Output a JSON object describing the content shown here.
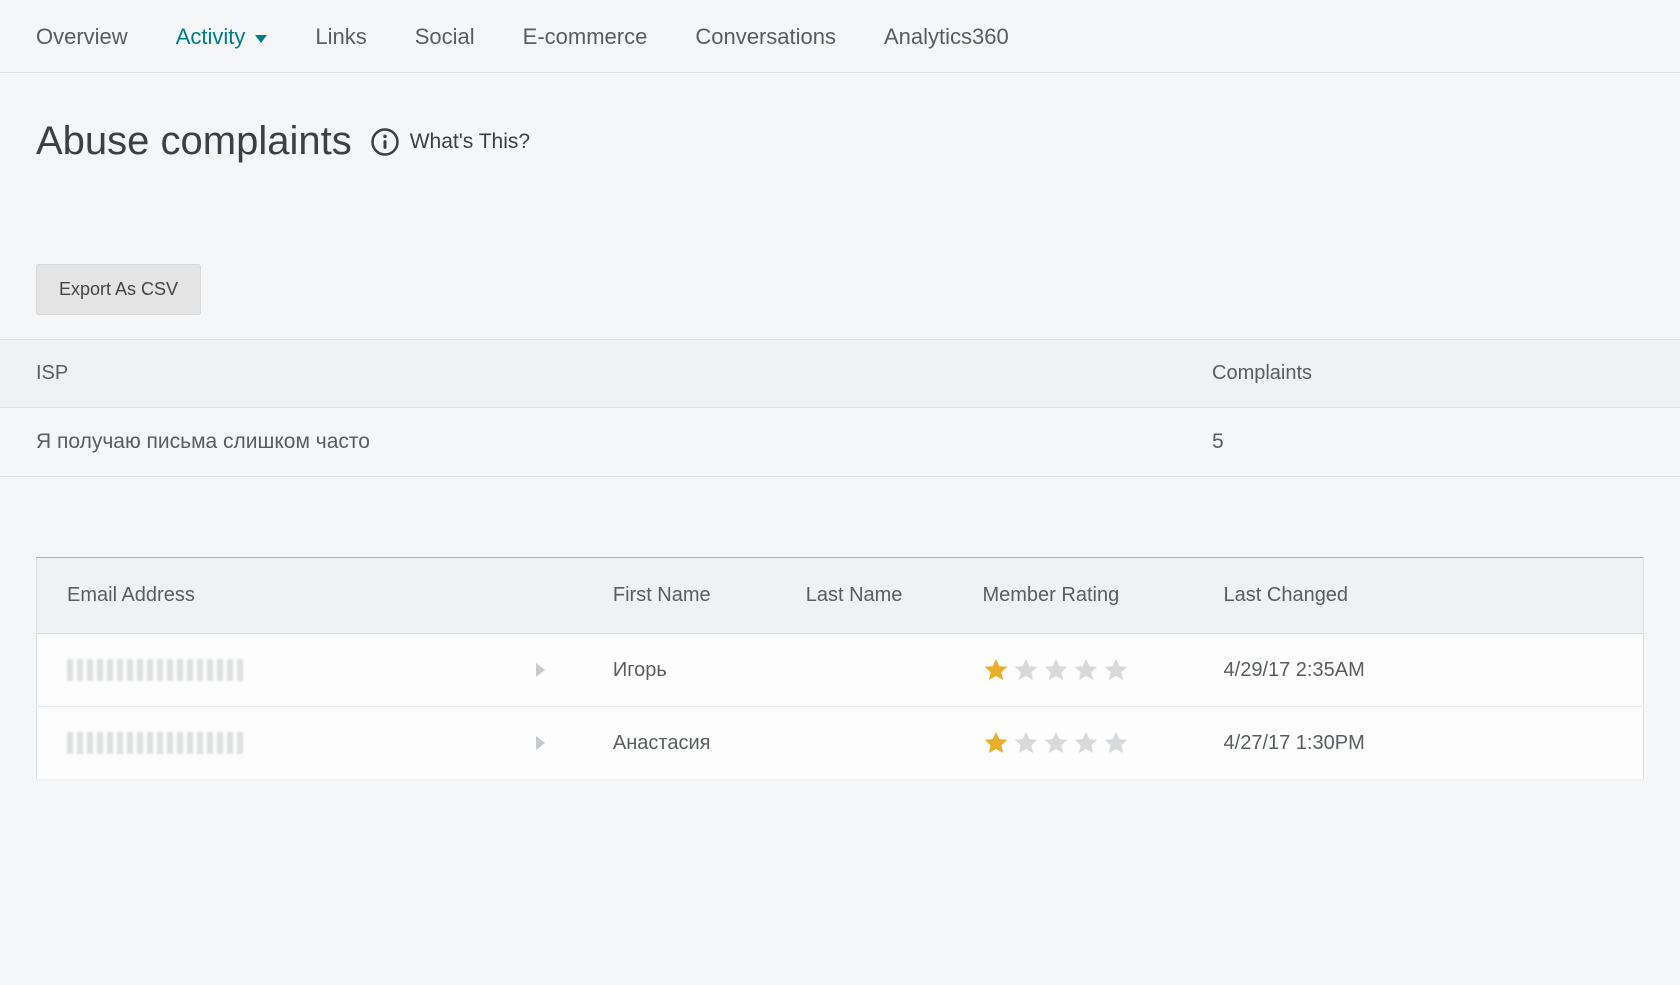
{
  "tabs": {
    "overview": "Overview",
    "activity": "Activity",
    "links": "Links",
    "social": "Social",
    "ecommerce": "E-commerce",
    "conversations": "Conversations",
    "analytics360": "Analytics360"
  },
  "header": {
    "title": "Abuse complaints",
    "whats_this": "What's This?"
  },
  "actions": {
    "export_label": "Export As CSV"
  },
  "summary": {
    "headers": {
      "isp": "ISP",
      "complaints": "Complaints"
    },
    "row": {
      "isp": "Я получаю письма слишком часто",
      "complaints": "5"
    }
  },
  "detail": {
    "headers": {
      "email": "Email Address",
      "first_name": "First Name",
      "last_name": "Last Name",
      "member_rating": "Member Rating",
      "last_changed": "Last Changed"
    },
    "rows": [
      {
        "first_name": "Игорь",
        "last_name": "",
        "rating": 1,
        "last_changed": "4/29/17 2:35AM"
      },
      {
        "first_name": "Анастасия",
        "last_name": "",
        "rating": 1,
        "last_changed": "4/27/17 1:30PM"
      }
    ]
  },
  "colors": {
    "accent": "#007c88",
    "star_filled": "#e9af2b",
    "star_empty": "#d7d9db"
  }
}
